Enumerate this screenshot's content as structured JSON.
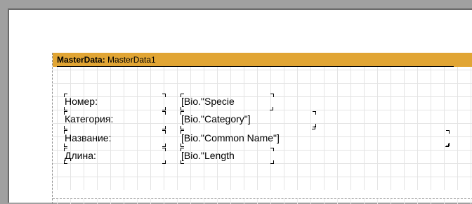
{
  "band": {
    "type_label": "MasterData:",
    "name": " MasterData1",
    "header_color": "#e1a534"
  },
  "rows": [
    {
      "label": "Номер:",
      "value": "[Bio.\"Specie"
    },
    {
      "label": "Категория:",
      "value": "[Bio.\"Category\"]"
    },
    {
      "label": "Название:",
      "value": "[Bio.\"Common Name\"]"
    },
    {
      "label": "Длина:",
      "value": "[Bio.\"Length"
    }
  ]
}
